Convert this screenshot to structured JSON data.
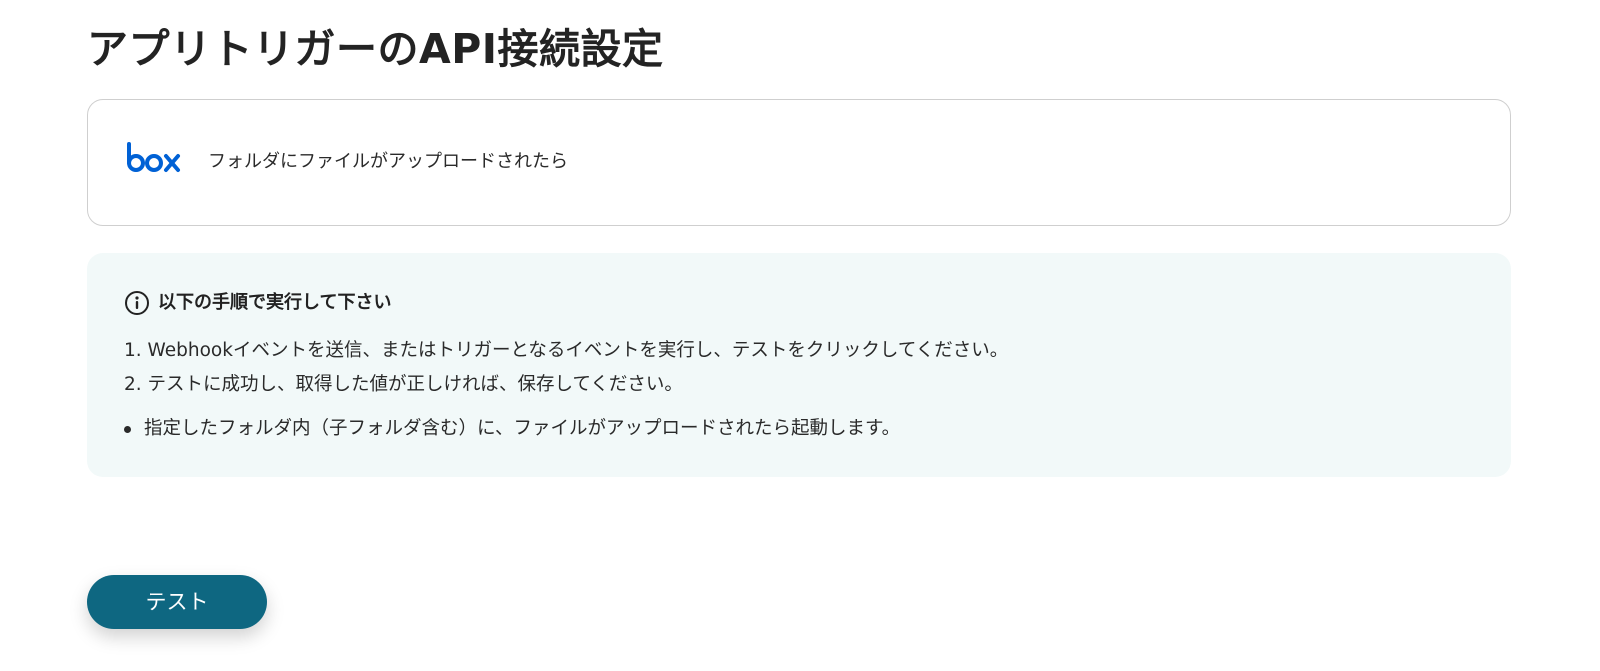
{
  "page": {
    "title": "アプリトリガーのAPI接続設定"
  },
  "trigger": {
    "app_icon": "box-logo-icon",
    "app_logo_text": "box",
    "label": "フォルダにファイルがアップロードされたら"
  },
  "instructions": {
    "icon": "info-icon",
    "title": "以下の手順で実行して下さい",
    "steps": [
      "1. Webhookイベントを送信、またはトリガーとなるイベントを実行し、テストをクリックしてください。",
      "2. テストに成功し、取得した値が正しければ、保存してください。"
    ],
    "notes": [
      "指定したフォルダ内（子フォルダ含む）に、ファイルがアップロードされたら起動します。"
    ]
  },
  "actions": {
    "test_label": "テスト"
  },
  "colors": {
    "brand_button": "#0e6781",
    "panel_background": "#f2f9f9",
    "box_blue": "#0061d5",
    "card_border": "#cfcfcf"
  }
}
